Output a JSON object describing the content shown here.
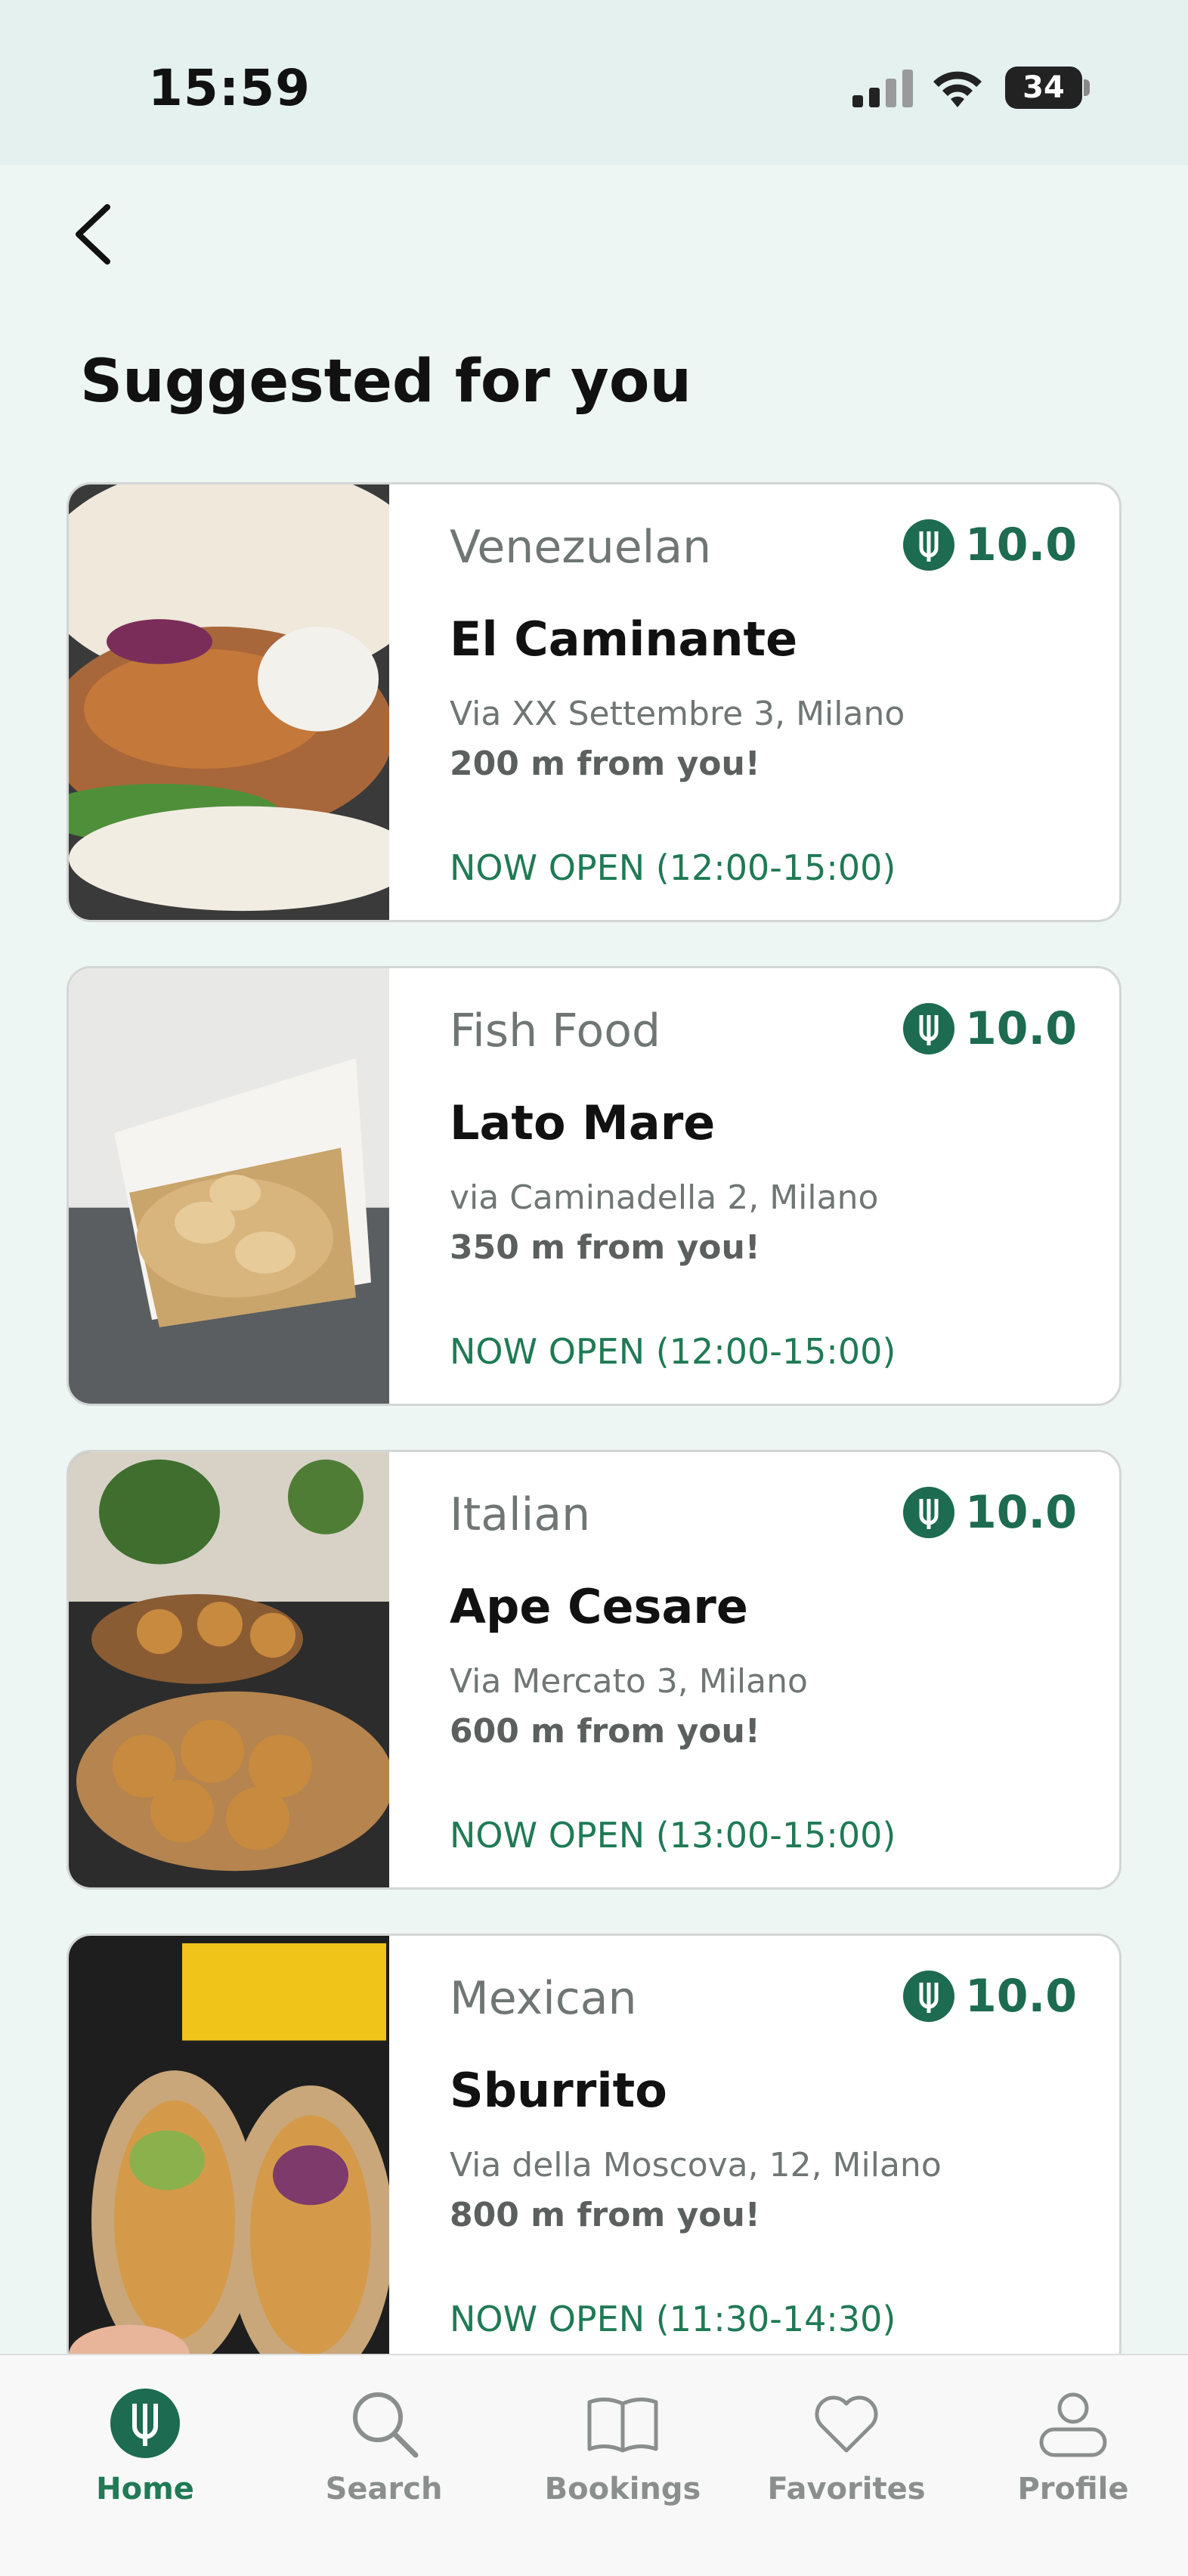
{
  "status_bar": {
    "time": "15:59",
    "battery": "34"
  },
  "header": {
    "title": "Suggested for you"
  },
  "restaurants": [
    {
      "cuisine": "Venezuelan",
      "rating": "10.0",
      "name": "El Caminante",
      "address": "Via XX Settembre 3, Milano",
      "distance": "200 m from you!",
      "status": "NOW OPEN (12:00-15:00)"
    },
    {
      "cuisine": "Fish Food",
      "rating": "10.0",
      "name": "Lato Mare",
      "address": "via Caminadella 2, Milano",
      "distance": "350 m from you!",
      "status": "NOW OPEN (12:00-15:00)"
    },
    {
      "cuisine": "Italian",
      "rating": "10.0",
      "name": "Ape Cesare",
      "address": "Via Mercato 3, Milano",
      "distance": "600 m from you!",
      "status": "NOW OPEN (13:00-15:00)"
    },
    {
      "cuisine": "Mexican",
      "rating": "10.0",
      "name": "Sburrito",
      "address": "Via della Moscova, 12, Milano",
      "distance": "800 m from you!",
      "status": "NOW OPEN (11:30-14:30)"
    }
  ],
  "tab_bar": {
    "tabs": [
      {
        "label": "Home",
        "icon": "home-fork-icon",
        "active": true
      },
      {
        "label": "Search",
        "icon": "search-icon",
        "active": false
      },
      {
        "label": "Bookings",
        "icon": "book-icon",
        "active": false
      },
      {
        "label": "Favorites",
        "icon": "heart-icon",
        "active": false
      },
      {
        "label": "Profile",
        "icon": "person-icon",
        "active": false
      }
    ]
  },
  "colors": {
    "accent": "#1d6b51",
    "background": "#eef6f4",
    "inactive": "#8a8f8e"
  }
}
